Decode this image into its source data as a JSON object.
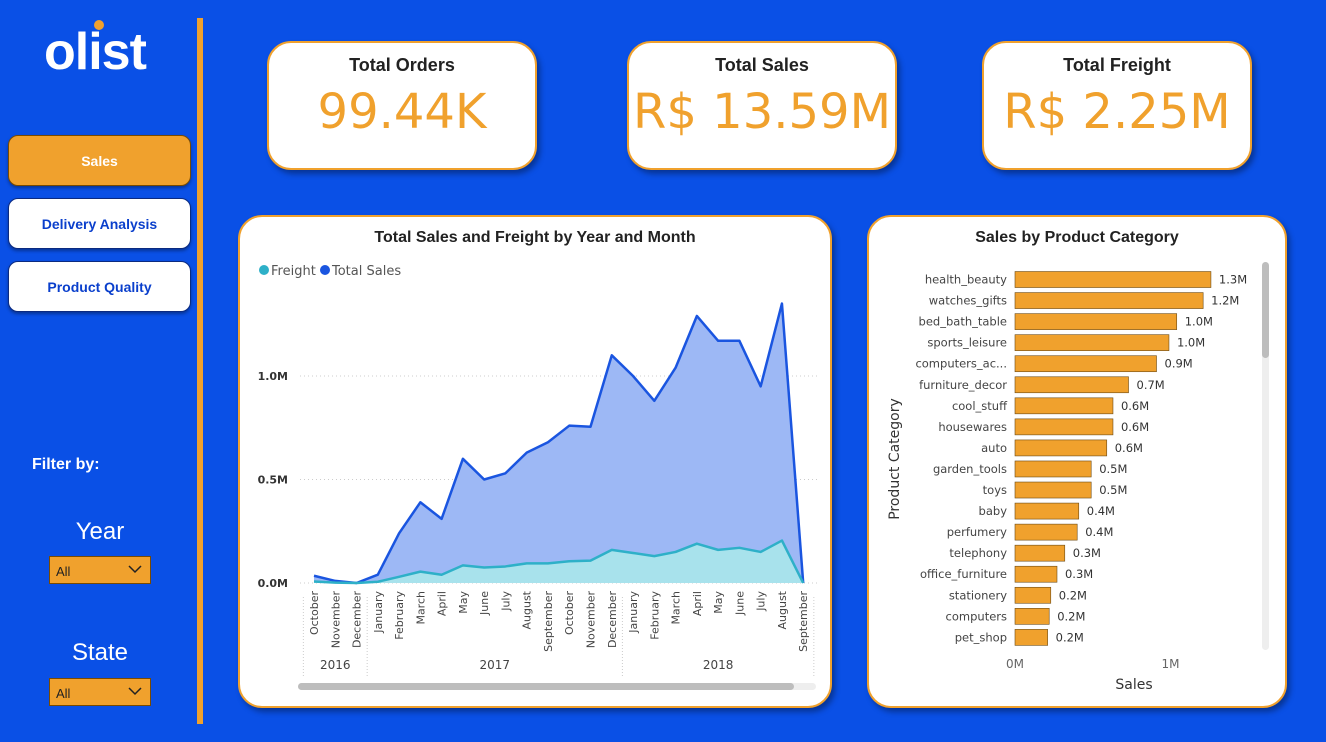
{
  "brand": {
    "logo_text": "olist"
  },
  "nav": [
    {
      "label": "Sales",
      "active": true
    },
    {
      "label": "Delivery Analysis",
      "active": false
    },
    {
      "label": "Product Quality",
      "active": false
    }
  ],
  "filters": {
    "title": "Filter by:",
    "year": {
      "label": "Year",
      "value": "All"
    },
    "state": {
      "label": "State",
      "value": "All"
    }
  },
  "kpis": [
    {
      "title": "Total Orders",
      "value": "99.44K"
    },
    {
      "title": "Total Sales",
      "value": "R$ 13.59M"
    },
    {
      "title": "Total Freight",
      "value": "R$ 2.25M"
    }
  ],
  "colors": {
    "background": "#0a50e6",
    "accent": "#f0a12d",
    "total_sales": "#1a55e0",
    "freight": "#2eb0c8"
  },
  "chart_data": [
    {
      "type": "area",
      "title": "Total Sales and Freight by Year and Month",
      "legend": {
        "position": "top-left",
        "entries": [
          "Freight",
          "Total Sales"
        ]
      },
      "categories": [
        "October",
        "November",
        "December",
        "January",
        "February",
        "March",
        "April",
        "May",
        "June",
        "July",
        "August",
        "September",
        "October",
        "November",
        "December",
        "January",
        "February",
        "March",
        "April",
        "May",
        "June",
        "July",
        "August",
        "September"
      ],
      "year_groups": [
        {
          "label": "2016",
          "count": 3
        },
        {
          "label": "2017",
          "count": 12
        },
        {
          "label": "2018",
          "count": 9
        }
      ],
      "series": [
        {
          "name": "Total Sales",
          "values": [
            0.035,
            0.01,
            0.0,
            0.04,
            0.24,
            0.39,
            0.31,
            0.6,
            0.5,
            0.53,
            0.63,
            0.68,
            0.76,
            0.755,
            1.1,
            1.0,
            0.88,
            1.04,
            1.29,
            1.17,
            1.17,
            0.95,
            1.35,
            0.0
          ]
        },
        {
          "name": "Freight",
          "values": [
            0.007,
            0.002,
            0.0,
            0.006,
            0.03,
            0.055,
            0.04,
            0.085,
            0.075,
            0.08,
            0.095,
            0.095,
            0.105,
            0.108,
            0.16,
            0.145,
            0.13,
            0.15,
            0.19,
            0.16,
            0.17,
            0.15,
            0.205,
            0.0
          ]
        }
      ],
      "y_ticks": [
        "0.0M",
        "0.5M",
        "1.0M"
      ],
      "ylim": [
        0,
        1.5
      ],
      "y_unit": "M",
      "grid": true
    },
    {
      "type": "bar",
      "orientation": "horizontal",
      "title": "Sales by Product Category",
      "xlabel": "Sales",
      "ylabel": "Product Category",
      "x_ticks": [
        "0M",
        "1M"
      ],
      "xlim": [
        0,
        1.8
      ],
      "categories": [
        "health_beauty",
        "watches_gifts",
        "bed_bath_table",
        "sports_leisure",
        "computers_ac...",
        "furniture_decor",
        "cool_stuff",
        "housewares",
        "auto",
        "garden_tools",
        "toys",
        "baby",
        "perfumery",
        "telephony",
        "office_furniture",
        "stationery",
        "computers",
        "pet_shop"
      ],
      "values": [
        1.26,
        1.21,
        1.04,
        0.99,
        0.91,
        0.73,
        0.63,
        0.63,
        0.59,
        0.49,
        0.49,
        0.41,
        0.4,
        0.32,
        0.27,
        0.23,
        0.22,
        0.21
      ],
      "data_labels": [
        "1.3M",
        "1.2M",
        "1.0M",
        "1.0M",
        "0.9M",
        "0.7M",
        "0.6M",
        "0.6M",
        "0.6M",
        "0.5M",
        "0.5M",
        "0.4M",
        "0.4M",
        "0.3M",
        "0.3M",
        "0.2M",
        "0.2M",
        "0.2M"
      ]
    }
  ]
}
